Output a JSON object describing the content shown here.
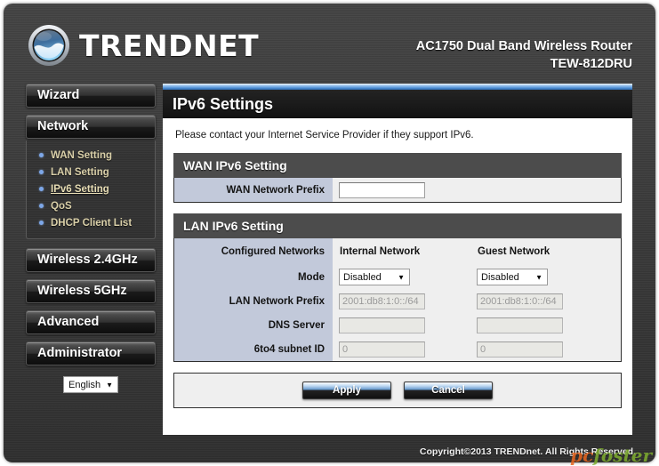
{
  "brand": {
    "logo_icon": "trendnet-globe-icon",
    "name": "TRENDNET"
  },
  "header": {
    "product_line": "AC1750 Dual Band Wireless Router",
    "model": "TEW-812DRU"
  },
  "sidebar": {
    "buttons": [
      {
        "label": "Wizard",
        "name": "wizard"
      },
      {
        "label": "Network",
        "name": "network"
      },
      {
        "label": "Wireless 2.4GHz",
        "name": "wireless-24ghz"
      },
      {
        "label": "Wireless 5GHz",
        "name": "wireless-5ghz"
      },
      {
        "label": "Advanced",
        "name": "advanced"
      },
      {
        "label": "Administrator",
        "name": "administrator"
      }
    ],
    "network_submenu": [
      {
        "label": "WAN Setting",
        "active": false
      },
      {
        "label": "LAN Setting",
        "active": false
      },
      {
        "label": "IPv6 Setting",
        "active": true
      },
      {
        "label": "QoS",
        "active": false
      },
      {
        "label": "DHCP Client List",
        "active": false
      }
    ],
    "language": {
      "selected": "English",
      "caret_icon": "chevron-down-icon"
    }
  },
  "main": {
    "page_title": "IPv6 Settings",
    "intro": "Please contact your Internet Service Provider if they support IPv6.",
    "wan_panel": {
      "heading": "WAN IPv6 Setting",
      "rows": [
        {
          "label": "WAN Network Prefix",
          "value": "",
          "placeholder": ""
        }
      ]
    },
    "lan_panel": {
      "heading": "LAN IPv6 Setting",
      "configured_networks_label": "Configured Networks",
      "columns": [
        "Internal Network",
        "Guest Network"
      ],
      "rows": [
        {
          "label": "Mode",
          "type": "select",
          "values": [
            "Disabled",
            "Disabled"
          ],
          "caret_icon": "chevron-down-icon"
        },
        {
          "label": "LAN Network Prefix",
          "type": "text-disabled",
          "values": [
            "2001:db8:1:0::/64",
            "2001:db8:1:0::/64"
          ]
        },
        {
          "label": "DNS Server",
          "type": "text-disabled",
          "values": [
            "",
            ""
          ]
        },
        {
          "label": "6to4 subnet ID",
          "type": "text-disabled",
          "values": [
            "0",
            "0"
          ]
        }
      ]
    },
    "actions": {
      "apply_label": "Apply",
      "cancel_label": "Cancel"
    }
  },
  "footer": {
    "copyright": "Copyright©2013 TRENDnet. All Rights Reserved.",
    "watermark_a": "pc",
    "watermark_b": "foster"
  },
  "colors": {
    "accent_blue": "#4d8fd6",
    "label_cell": "#c2c9da",
    "panel_head": "#4c4c4c",
    "submenu_text": "#d9cfa8",
    "bullet": "#7da7e8"
  }
}
